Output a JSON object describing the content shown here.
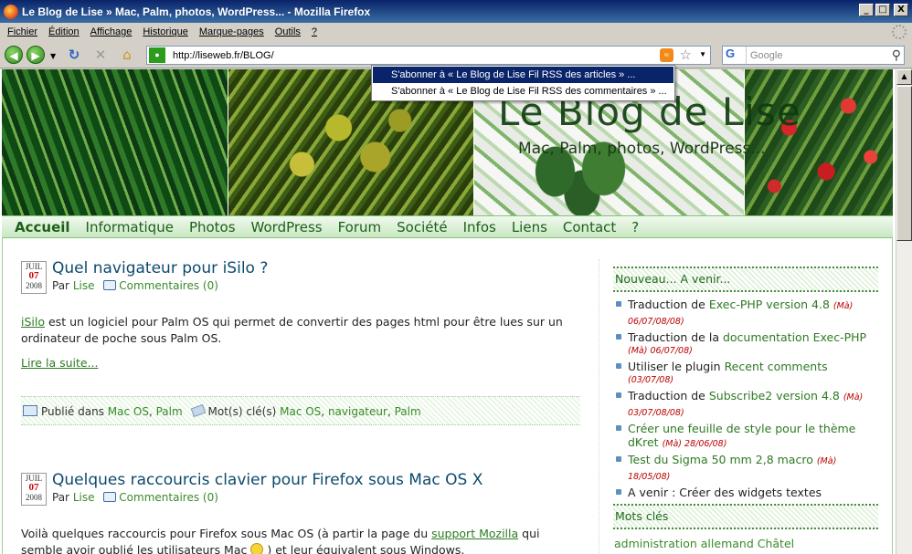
{
  "window": {
    "title": "Le Blog de Lise » Mac, Palm, photos, WordPress... - Mozilla Firefox",
    "buttons": {
      "minimize": "_",
      "maximize": "□",
      "close": "X"
    }
  },
  "menubar": [
    "Fichier",
    "Édition",
    "Affichage",
    "Historique",
    "Marque-pages",
    "Outils",
    "?"
  ],
  "toolbar": {
    "url": "http://liseweb.fr/BLOG/",
    "search_placeholder": "Google"
  },
  "rss_menu": [
    "S'abonner à « Le Blog de Lise Fil RSS des articles » ...",
    "S'abonner à « Le Blog de Lise Fil RSS des commentaires » ..."
  ],
  "site": {
    "title": "Le Blog de Lise",
    "tagline": "Mac, Palm, photos, WordPress..."
  },
  "nav": [
    "Accueil",
    "Informatique",
    "Photos",
    "WordPress",
    "Forum",
    "Société",
    "Infos",
    "Liens",
    "Contact",
    "?"
  ],
  "posts": [
    {
      "month": "JUIL",
      "day": "07",
      "year": "2008",
      "title": "Quel navigateur pour iSilo ?",
      "by": "Par",
      "author": "Lise",
      "comments": "Commentaires (0)",
      "body_link": "iSilo",
      "body_text": " est un logiciel pour Palm OS qui permet de convertir des pages html pour être lues sur un ordinateur de poche sous Palm OS.",
      "more": "Lire la suite...",
      "published_label": "Publié dans",
      "categories": [
        "Mac OS",
        "Palm"
      ],
      "tags_label": "Mot(s) clé(s)",
      "tags": [
        "Mac OS",
        "navigateur",
        "Palm"
      ]
    },
    {
      "month": "JUIL",
      "day": "07",
      "year": "2008",
      "title": "Quelques raccourcis clavier pour Firefox sous Mac OS X",
      "by": "Par",
      "author": "Lise",
      "comments": "Commentaires (0)",
      "body_text1": "Voilà quelques raccourcis pour Firefox sous Mac OS (à partir la page du ",
      "body_link": "support Mozilla",
      "body_text2": " qui semble avoir oublié les utilisateurs Mac",
      "body_text3": ") et leur équivalent sous Windows."
    }
  ],
  "sidebar": {
    "news_title": "Nouveau... A venir...",
    "news": [
      {
        "pre": "Traduction de ",
        "link": "Exec-PHP version 4.8",
        "date": "(Mà) 06/07/08/08)"
      },
      {
        "pre": "Traduction de la ",
        "link": "documentation Exec-PHP",
        "date": "(Mà) 06/07/08)"
      },
      {
        "pre": "Utiliser le plugin ",
        "link": "Recent comments",
        "date": "(03/07/08)"
      },
      {
        "pre": "Traduction de ",
        "link": "Subscribe2 version 4.8",
        "date": "(Mà) 03/07/08/08)"
      },
      {
        "pre": "",
        "link": "Créer une feuille de style pour le thème dKret",
        "date": "(Mà) 28/06/08)"
      },
      {
        "pre": "",
        "link": "Test du Sigma 50 mm 2,8 macro",
        "date": "(Mà) 18/05/08)"
      },
      {
        "pre": "A venir : Créer des widgets textes",
        "link": "",
        "date": ""
      }
    ],
    "tags_title": "Mots clés",
    "tags": "administration allemand Châtel"
  }
}
